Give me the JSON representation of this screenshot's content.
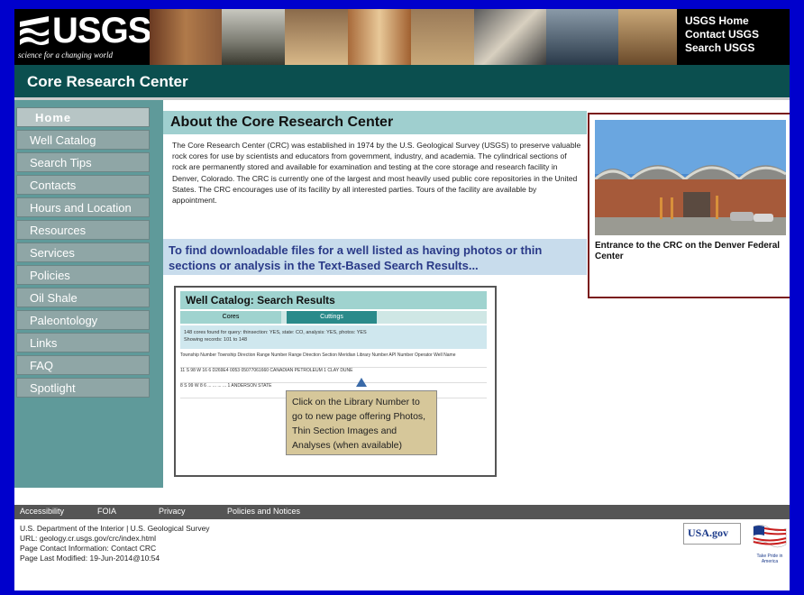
{
  "header": {
    "logo_text": "USGS",
    "logo_tagline": "science for a changing world",
    "links": [
      "USGS Home",
      "Contact USGS",
      "Search USGS"
    ],
    "site_title": "Core Research Center"
  },
  "sidebar": {
    "items": [
      {
        "label": "Home"
      },
      {
        "label": "Well Catalog"
      },
      {
        "label": "Search Tips"
      },
      {
        "label": "Contacts"
      },
      {
        "label": "Hours and Location"
      },
      {
        "label": "Resources"
      },
      {
        "label": "Services"
      },
      {
        "label": "Policies"
      },
      {
        "label": "Oil Shale"
      },
      {
        "label": "Paleontology"
      },
      {
        "label": "Links"
      },
      {
        "label": "FAQ"
      },
      {
        "label": "Spotlight"
      }
    ]
  },
  "main": {
    "about_title": "About the Core Research Center",
    "about_text": "The Core Research Center (CRC) was established in 1974 by the U.S. Geological Survey (USGS) to preserve valuable rock cores for use by scientists and educators from government, industry, and academia. The cylindrical sections of rock are permanently stored and available for examination and testing at the core storage and research facility in Denver, Colorado. The CRC is currently one of the largest and most heavily used public core repositories in the United States. The CRC encourages use of its facility by all interested parties. Tours of the facility are available by appointment.",
    "find_text": "To find downloadable files for a well listed as having photos or thin sections or analysis in the Text-Based Search Results...",
    "screenshot": {
      "title": "Well Catalog: Search Results",
      "tab1": "Cores",
      "tab2": "Cuttings",
      "info_line1": "148 cores found for query: thinsection: YES, state: CO, analysis: YES, photos: YES",
      "info_line2": "Showing records: 101 to 148",
      "headers": "Township Number   Township Direction   Range Number   Range Direction   Section   Meridian   Library Number   API Number   Operator   Well Name",
      "row1": "11   S   98   W   16   6   D269E4   0053   05077061660   CANADIAN PETROLEUM   1 CLAY DUNE",
      "row2": "8   S   99   W   8   6   ...   ...   ...   ...   1 ANDERSON STATE",
      "callout": "Click on the Library Number to go to new page offering Photos, Thin Section Images and Analyses (when available)"
    }
  },
  "photo": {
    "caption": "Entrance to the CRC on the Denver Federal Center"
  },
  "footer": {
    "links": [
      "Accessibility",
      "FOIA",
      "Privacy",
      "Policies and Notices"
    ],
    "line1": "U.S. Department of the Interior | U.S. Geological Survey",
    "line2": "URL: geology.cr.usgs.gov/crc/index.html",
    "line3": "Page Contact Information: Contact CRC",
    "line4": "Page Last Modified: 19-Jun-2014@10:54",
    "usagov": "USA.gov",
    "flag_caption": "Take Pride in America"
  }
}
